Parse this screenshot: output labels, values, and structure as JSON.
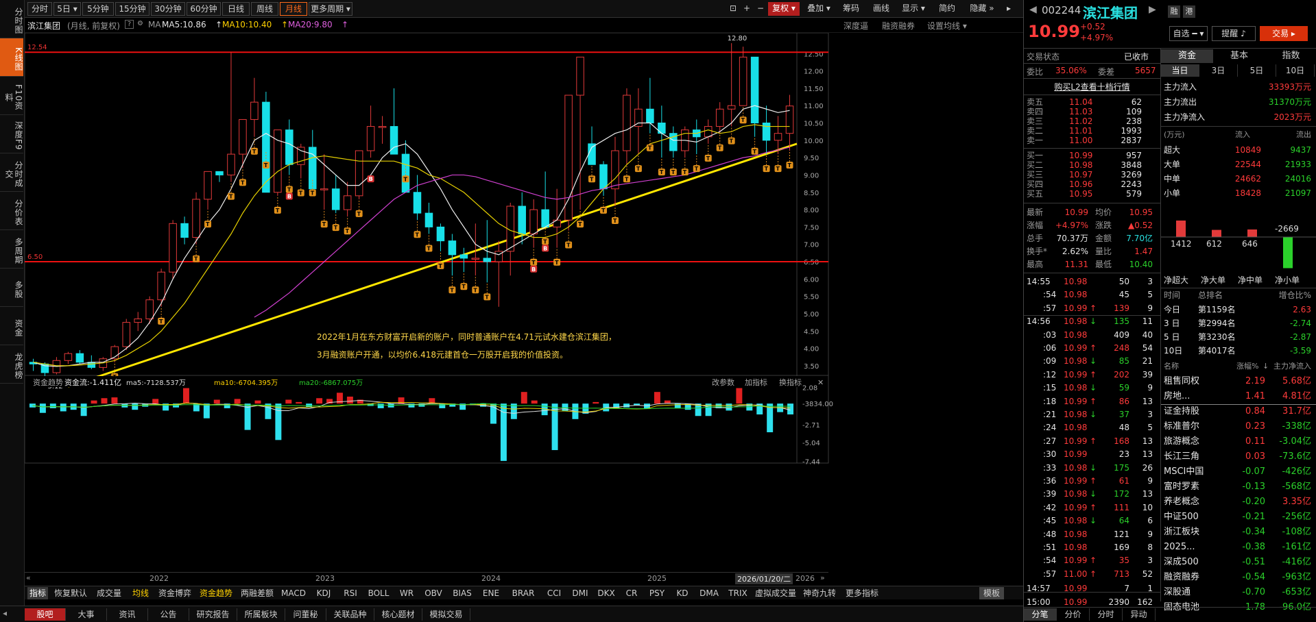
{
  "left_nav": [
    "分时图",
    "K线图",
    "F10资料",
    "深度F9",
    "分时成交",
    "分价表",
    "多周期",
    "多股",
    "资金",
    "龙虎榜"
  ],
  "period_buttons": [
    "分时",
    "5日",
    "5分钟",
    "15分钟",
    "30分钟",
    "60分钟",
    "日线",
    "周线",
    "月线",
    "更多周期"
  ],
  "toolbar": {
    "fuquan": "复权",
    "overlay": "叠加",
    "chips": "筹码",
    "draw": "画线",
    "display": "显示",
    "simple": "简约",
    "hide": "隐藏"
  },
  "info": {
    "name": "滨江集团",
    "mode": "(月线, 前复权)",
    "ma_label": "MA",
    "ma5": "MA5:10.86",
    "ma10": "MA10:10.40",
    "ma20": "MA20:9.80",
    "links": [
      "深度逼",
      "融资融券",
      "设置均线"
    ]
  },
  "chart_data": {
    "type": "candlestick",
    "y_ticks": [
      "12.50",
      "12.00",
      "11.50",
      "11.00",
      "10.50",
      "10.00",
      "9.50",
      "9.00",
      "8.50",
      "8.00",
      "7.50",
      "7.00",
      "6.50",
      "6.00",
      "5.50",
      "5.00",
      "4.50",
      "4.00",
      "3.50"
    ],
    "ylim": [
      3.3,
      12.9
    ],
    "x_ticks": [
      "2022",
      "2023",
      "2024",
      "2025"
    ],
    "date_box": "2026/01/20/二",
    "year_end": "2026",
    "hline_top": "12.54",
    "hline_bottom": "6.50",
    "max_label": "12.80",
    "min_label": "3.12",
    "annotation_1": "2022年1月在东方财富开启新的账户，同时普通账户在4.71元试水建仓滨江集团，",
    "annotation_2": "3月融资账户开通，以均价6.418元建首仓一万股开启我的价值投资。",
    "candles": [
      [
        3.6,
        3.7,
        3.35,
        3.55
      ],
      [
        3.55,
        3.6,
        3.12,
        3.3
      ],
      [
        3.3,
        3.75,
        3.25,
        3.65
      ],
      [
        3.65,
        3.9,
        3.55,
        3.85
      ],
      [
        3.85,
        3.95,
        3.55,
        3.6
      ],
      [
        3.6,
        3.8,
        3.4,
        3.45
      ],
      [
        3.45,
        3.75,
        3.35,
        3.7
      ],
      [
        3.7,
        4.1,
        3.6,
        4.05
      ],
      [
        4.05,
        4.85,
        3.95,
        4.75
      ],
      [
        4.75,
        5.05,
        4.5,
        4.85
      ],
      [
        4.85,
        5.5,
        4.7,
        5.4
      ],
      [
        5.4,
        6.3,
        5.2,
        6.2
      ],
      [
        6.2,
        7.7,
        6.0,
        7.6
      ],
      [
        7.6,
        7.8,
        7.0,
        7.2
      ],
      [
        7.2,
        8.5,
        7.0,
        8.3
      ],
      [
        8.3,
        9.1,
        8.0,
        9.1
      ],
      [
        9.1,
        9.1,
        8.8,
        9.0
      ],
      [
        9.0,
        12.54,
        8.8,
        9.6
      ],
      [
        9.6,
        10.6,
        9.2,
        10.6
      ],
      [
        10.6,
        11.8,
        10.1,
        11.1
      ],
      [
        11.1,
        11.4,
        9.7,
        8.5
      ],
      [
        8.5,
        10.3,
        8.4,
        10.3
      ],
      [
        10.3,
        10.6,
        9.0,
        9.3
      ],
      [
        9.3,
        9.9,
        8.9,
        9.8
      ],
      [
        9.8,
        10.3,
        8.9,
        8.6
      ],
      [
        8.6,
        9.6,
        8.0,
        8.6
      ],
      [
        8.6,
        9.0,
        7.9,
        8.0
      ],
      [
        8.0,
        8.8,
        7.8,
        8.4
      ],
      [
        8.4,
        9.7,
        8.3,
        9.7
      ],
      [
        9.7,
        11.0,
        9.5,
        10.4
      ],
      [
        10.4,
        10.7,
        9.9,
        10.4
      ],
      [
        10.4,
        11.5,
        9.6,
        9.6
      ],
      [
        9.6,
        10.0,
        9.3,
        8.5
      ],
      [
        8.5,
        9.0,
        7.7,
        7.9
      ],
      [
        7.9,
        8.2,
        7.3,
        7.5
      ],
      [
        7.5,
        7.6,
        6.8,
        7.1
      ],
      [
        7.1,
        7.3,
        6.1,
        6.7
      ],
      [
        6.7,
        6.9,
        6.2,
        6.6
      ],
      [
        6.6,
        7.6,
        6.1,
        6.6
      ],
      [
        6.6,
        7.7,
        5.9,
        6.5
      ],
      [
        6.5,
        7.1,
        5.2,
        6.8
      ],
      [
        6.8,
        8.2,
        6.1,
        8.1
      ],
      [
        8.1,
        8.5,
        7.0,
        7.3
      ],
      [
        7.3,
        8.3,
        6.9,
        8.0
      ],
      [
        8.0,
        9.1,
        7.5,
        7.5
      ],
      [
        7.5,
        8.6,
        6.9,
        7.7
      ],
      [
        7.7,
        11.3,
        7.4,
        11.3
      ],
      [
        11.3,
        11.7,
        8.0,
        12.4
      ],
      [
        9.9,
        10.4,
        9.3,
        9.3
      ],
      [
        9.3,
        9.4,
        8.4,
        8.6
      ],
      [
        8.6,
        10.1,
        8.1,
        9.7
      ],
      [
        9.7,
        11.5,
        9.3,
        11.3
      ],
      [
        10.4,
        11.5,
        9.6,
        10.9
      ],
      [
        10.9,
        11.8,
        10.2,
        10.5
      ],
      [
        10.5,
        11.0,
        9.5,
        10.2
      ],
      [
        10.2,
        10.4,
        9.5,
        9.7
      ],
      [
        9.7,
        10.4,
        9.5,
        10.3
      ],
      [
        10.3,
        10.6,
        9.6,
        10.1
      ],
      [
        10.1,
        10.6,
        9.9,
        10.4
      ],
      [
        10.4,
        11.1,
        10.2,
        10.9
      ],
      [
        10.9,
        12.8,
        10.4,
        11.0
      ],
      [
        11.0,
        12.7,
        11.0,
        12.4
      ],
      [
        12.4,
        12.4,
        10.1,
        10.5
      ],
      [
        10.5,
        11.0,
        9.6,
        10.0
      ],
      [
        10.0,
        10.7,
        9.6,
        10.2
      ],
      [
        10.2,
        11.31,
        9.7,
        10.99
      ]
    ],
    "ma5": [
      3.6,
      3.5,
      3.48,
      3.5,
      3.55,
      3.6,
      3.6,
      3.75,
      4.0,
      4.3,
      4.75,
      5.3,
      6.0,
      6.6,
      7.1,
      7.6,
      8.0,
      8.6,
      9.3,
      10.0,
      10.2,
      10.0,
      9.9,
      9.7,
      9.6,
      9.3,
      9.0,
      8.7,
      8.7,
      9.0,
      9.5,
      9.8,
      9.9,
      9.6,
      9.1,
      8.6,
      8.0,
      7.5,
      7.0,
      6.8,
      6.7,
      6.9,
      7.1,
      7.3,
      7.5,
      7.7,
      8.3,
      9.1,
      9.8,
      10.0,
      10.2,
      10.3,
      10.5,
      10.5,
      10.2,
      10.0,
      10.0,
      9.95,
      10.1,
      10.25,
      10.5,
      10.9,
      11.0,
      10.9,
      10.8,
      10.86
    ],
    "ma10": [
      3.6,
      3.55,
      3.5,
      3.5,
      3.52,
      3.55,
      3.58,
      3.65,
      3.8,
      4.0,
      4.2,
      4.5,
      4.9,
      5.3,
      5.8,
      6.3,
      6.8,
      7.3,
      7.9,
      8.4,
      8.8,
      9.1,
      9.3,
      9.4,
      9.5,
      9.55,
      9.5,
      9.45,
      9.4,
      9.4,
      9.4,
      9.4,
      9.3,
      9.2,
      9.0,
      8.9,
      8.7,
      8.5,
      8.2,
      7.9,
      7.6,
      7.4,
      7.3,
      7.2,
      7.2,
      7.3,
      7.5,
      7.8,
      8.2,
      8.6,
      8.9,
      9.3,
      9.6,
      9.9,
      10.0,
      10.1,
      10.2,
      10.2,
      10.3,
      10.2,
      10.25,
      10.4,
      10.45,
      10.4,
      10.4,
      10.4
    ],
    "ma20": [
      null,
      null,
      null,
      null,
      null,
      null,
      null,
      null,
      null,
      null,
      null,
      null,
      null,
      null,
      null,
      null,
      null,
      null,
      null,
      4.9,
      5.1,
      5.35,
      5.6,
      5.9,
      6.2,
      6.5,
      6.8,
      7.1,
      7.4,
      7.7,
      8.0,
      8.3,
      8.5,
      8.7,
      8.8,
      8.9,
      9.0,
      9.0,
      8.95,
      8.85,
      8.75,
      8.65,
      8.55,
      8.45,
      8.35,
      8.3,
      8.35,
      8.45,
      8.55,
      8.6,
      8.7,
      8.75,
      8.8,
      8.85,
      8.9,
      8.95,
      9.0,
      9.1,
      9.2,
      9.3,
      9.4,
      9.5,
      9.55,
      9.65,
      9.72,
      9.8
    ],
    "flow": {
      "label": "资金趋势",
      "value_label": "资金流:-1.411亿",
      "ma5_label": "ma5:-7128.537万",
      "ma10_label": "ma10:-6704.395万",
      "ma20_label": "ma20:-6867.075万",
      "links": [
        "改参数",
        "加指标",
        "换指标"
      ],
      "y_ticks": [
        "2.08",
        "-3834.00",
        "-2.71",
        "-5.04",
        "-7.44"
      ],
      "bars": [
        -0.5,
        -1.2,
        -0.6,
        -1.0,
        -0.8,
        -1.6,
        0.4,
        0.7,
        0.8,
        -0.5,
        -0.8,
        -0.4,
        0.6,
        -0.9,
        -0.5,
        2.0,
        -1.0,
        -1.9,
        0.5,
        -0.6,
        0.6,
        -3.4,
        0.4,
        -2.0,
        -4.7,
        0.5,
        0.2,
        -0.5,
        0.7,
        0.6,
        1.4,
        0.9,
        0.5,
        -0.3,
        -0.6,
        -0.5,
        0.8,
        -0.5,
        -0.4,
        0.7,
        -0.6,
        -0.4,
        -0.8,
        -0.2,
        -0.4,
        -2.6,
        -7.4,
        -2.0,
        1.5,
        0.4,
        -1.5,
        -6.0,
        -1.0,
        -2.0,
        -1.3,
        0.2,
        -1.0,
        -0.6,
        -0.5,
        -0.2,
        -0.7,
        1.5,
        0.4,
        -0.6,
        -0.8,
        -1.6,
        -1.6,
        -0.6,
        -0.9,
        2.0,
        -0.9,
        -1.4,
        -3.7,
        -1.1,
        -1.4
      ]
    }
  },
  "indicator_tabs": [
    "指标",
    "恢复默认",
    "成交量",
    "均线",
    "资金博弈",
    "资金趋势",
    "两融差额",
    "MACD",
    "KDJ",
    "RSI",
    "BOLL",
    "WR",
    "OBV",
    "BIAS",
    "ENE",
    "BRAR",
    "CCI",
    "DMI",
    "DKX",
    "CR",
    "PSY",
    "KD",
    "DMA",
    "TRIX",
    "虚拟成交量",
    "神奇九转",
    "更多指标",
    "模板"
  ],
  "bottom_tabs": [
    "股吧",
    "大事",
    "资讯",
    "公告",
    "研究报告",
    "所属板块",
    "问董秘",
    "关联品种",
    "核心题材",
    "模拟交易"
  ],
  "stock": {
    "code": "002244",
    "name": "滨江集团",
    "price": "10.99",
    "change": "+0.52",
    "pct": "+4.97%",
    "tags": [
      "融",
      "港"
    ]
  },
  "right_buttons": {
    "watch": "自选",
    "alert": "提醒",
    "trade": "交易"
  },
  "status": {
    "label": "交易状态",
    "value": "已收市"
  },
  "webi": {
    "label": "委比",
    "value": "35.06%",
    "diff_label": "委差",
    "diff": "5657"
  },
  "l2_link": "购买L2查看十档行情",
  "asks": [
    [
      "卖五",
      "11.04",
      "62"
    ],
    [
      "卖四",
      "11.03",
      "109"
    ],
    [
      "卖三",
      "11.02",
      "238"
    ],
    [
      "卖二",
      "11.01",
      "1993"
    ],
    [
      "卖一",
      "11.00",
      "2837"
    ]
  ],
  "bids": [
    [
      "买一",
      "10.99",
      "957"
    ],
    [
      "买二",
      "10.98",
      "3848"
    ],
    [
      "买三",
      "10.97",
      "3269"
    ],
    [
      "买四",
      "10.96",
      "2243"
    ],
    [
      "买五",
      "10.95",
      "579"
    ]
  ],
  "quote": [
    [
      "最新",
      "10.99",
      "均价",
      "10.95"
    ],
    [
      "涨幅",
      "+4.97%",
      "涨跌",
      "▲0.52"
    ],
    [
      "总手",
      "70.37万",
      "金额",
      "7.70亿"
    ],
    [
      "换手*",
      "2.62%",
      "量比",
      "1.47"
    ],
    [
      "最高",
      "11.31",
      "最低",
      "10.40"
    ]
  ],
  "ticks": [
    [
      "14:55",
      "10.98",
      "50",
      "3",
      ""
    ],
    [
      ":54",
      "10.98",
      "45",
      "5",
      ""
    ],
    [
      ":57",
      "10.99",
      "139",
      "9",
      "up"
    ],
    [
      "14:56",
      "10.98",
      "135",
      "11",
      "dn"
    ],
    [
      ":03",
      "10.98",
      "409",
      "40",
      ""
    ],
    [
      ":06",
      "10.99",
      "248",
      "54",
      "up"
    ],
    [
      ":09",
      "10.98",
      "85",
      "21",
      "dn"
    ],
    [
      ":12",
      "10.99",
      "202",
      "39",
      "up"
    ],
    [
      ":15",
      "10.98",
      "59",
      "9",
      "dn"
    ],
    [
      ":18",
      "10.99",
      "86",
      "13",
      "up"
    ],
    [
      ":21",
      "10.98",
      "37",
      "3",
      "dn"
    ],
    [
      ":24",
      "10.98",
      "48",
      "5",
      ""
    ],
    [
      ":27",
      "10.99",
      "168",
      "13",
      "up"
    ],
    [
      ":30",
      "10.99",
      "23",
      "13",
      ""
    ],
    [
      ":33",
      "10.98",
      "175",
      "26",
      "dn"
    ],
    [
      ":36",
      "10.99",
      "61",
      "9",
      "up"
    ],
    [
      ":39",
      "10.98",
      "172",
      "13",
      "dn"
    ],
    [
      ":42",
      "10.99",
      "111",
      "10",
      "up"
    ],
    [
      ":45",
      "10.98",
      "64",
      "6",
      "dn"
    ],
    [
      ":48",
      "10.98",
      "121",
      "9",
      ""
    ],
    [
      ":51",
      "10.98",
      "169",
      "8",
      ""
    ],
    [
      ":54",
      "10.99",
      "35",
      "3",
      "up"
    ],
    [
      ":57",
      "11.00",
      "713",
      "52",
      "up"
    ],
    [
      "14:57",
      "10.99",
      "7",
      "1",
      ""
    ],
    [
      "15:00",
      "10.99",
      "2390",
      "162",
      ""
    ]
  ],
  "flow_tabs": [
    "资金",
    "基本",
    "指数"
  ],
  "flow_periods": [
    "当日",
    "3日",
    "5日",
    "10日"
  ],
  "main_flow": [
    [
      "主力流入",
      "33393万元"
    ],
    [
      "主力流出",
      "31370万元"
    ],
    [
      "主力净流入",
      "2023万元"
    ]
  ],
  "flow_table": {
    "unit": "(万元)",
    "in": "流入",
    "out": "流出",
    "rows": [
      [
        "超大",
        "10849",
        "9437"
      ],
      [
        "大单",
        "22544",
        "21933"
      ],
      [
        "中单",
        "24662",
        "24016"
      ],
      [
        "小单",
        "18428",
        "21097"
      ]
    ]
  },
  "net_bars": {
    "values": [
      1412,
      612,
      646,
      -2669
    ],
    "labels": [
      "1412",
      "612",
      "646",
      "-2669"
    ],
    "names": [
      "净超大",
      "净大单",
      "净中单",
      "净小单"
    ]
  },
  "rank": {
    "h1": "时间",
    "h2": "总排名",
    "h3": "增仓比%",
    "rows": [
      [
        "今日",
        "第1159名",
        "2.63"
      ],
      [
        "3 日",
        "第2994名",
        "-2.74"
      ],
      [
        "5 日",
        "第3230名",
        "-2.87"
      ],
      [
        "10日",
        "第4017名",
        "-3.59"
      ]
    ]
  },
  "sectors": {
    "h1": "名称",
    "h2": "涨幅%",
    "h3": "主力净流入",
    "rows": [
      [
        "租售同权",
        "2.19",
        "5.68亿"
      ],
      [
        "房地...",
        "1.41",
        "4.81亿"
      ],
      [
        "证金持股",
        "0.84",
        "31.7亿"
      ],
      [
        "标准普尔",
        "0.23",
        "-338亿"
      ],
      [
        "旅游概念",
        "0.11",
        "-3.04亿"
      ],
      [
        "长江三角",
        "0.03",
        "-73.6亿"
      ],
      [
        "MSCI中国",
        "-0.07",
        "-426亿"
      ],
      [
        "富时罗素",
        "-0.13",
        "-568亿"
      ],
      [
        "养老概念",
        "-0.20",
        "3.35亿"
      ],
      [
        "中证500",
        "-0.21",
        "-256亿"
      ],
      [
        "浙江板块",
        "-0.34",
        "-108亿"
      ],
      [
        "2025...",
        "-0.38",
        "-161亿"
      ],
      [
        "深成500",
        "-0.51",
        "-416亿"
      ],
      [
        "融资融券",
        "-0.54",
        "-963亿"
      ],
      [
        "深股通",
        "-0.70",
        "-653亿"
      ],
      [
        "固态电池",
        "-1.78",
        "-96.0亿"
      ]
    ]
  },
  "right_bottom_tabs": [
    "分笔",
    "分价",
    "分时",
    "异动"
  ]
}
